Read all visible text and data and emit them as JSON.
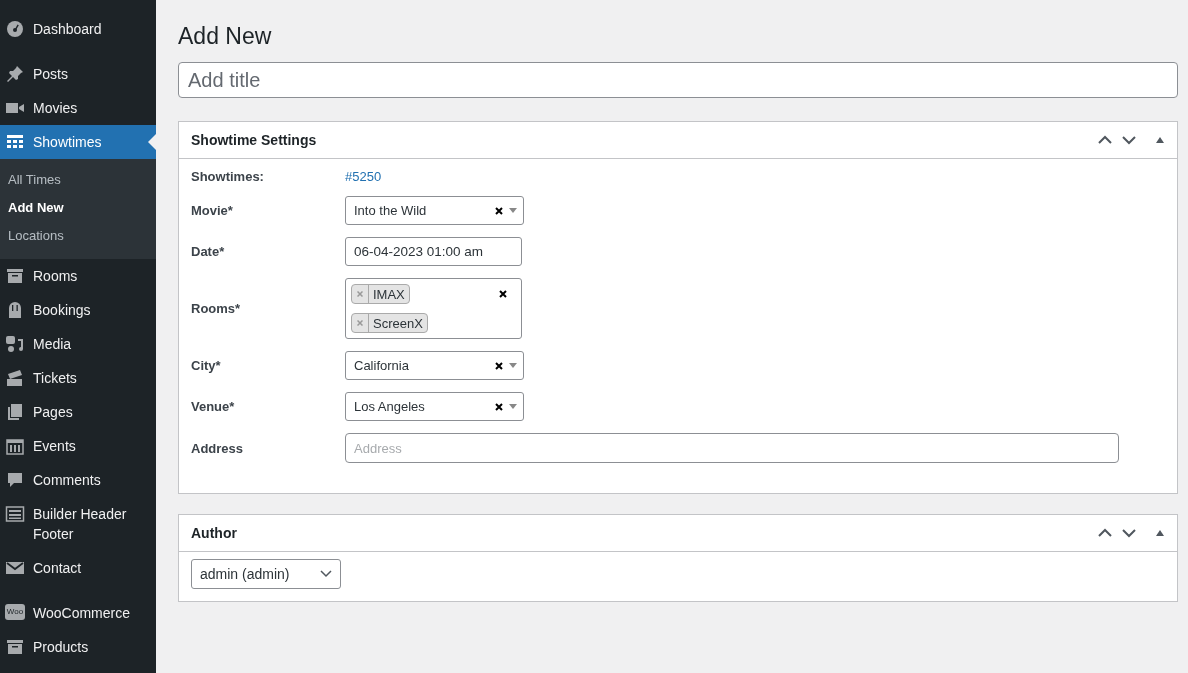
{
  "sidebar": {
    "groups": [
      [
        {
          "label": "Dashboard",
          "selected": false
        }
      ],
      [
        {
          "label": "Posts",
          "selected": false
        },
        {
          "label": "Movies",
          "selected": false
        },
        {
          "label": "Showtimes",
          "selected": true,
          "children": [
            {
              "label": "All Times",
              "selected": false
            },
            {
              "label": "Add New",
              "selected": true
            },
            {
              "label": "Locations",
              "selected": false
            }
          ]
        },
        {
          "label": "Rooms",
          "selected": false
        },
        {
          "label": "Bookings",
          "selected": false
        },
        {
          "label": "Media",
          "selected": false
        },
        {
          "label": "Tickets",
          "selected": false
        },
        {
          "label": "Pages",
          "selected": false
        },
        {
          "label": "Events",
          "selected": false
        },
        {
          "label": "Comments",
          "selected": false
        },
        {
          "label": "Builder Header Footer",
          "selected": false
        },
        {
          "label": "Contact",
          "selected": false
        }
      ],
      [
        {
          "label": "WooCommerce",
          "icon_text": "Woo",
          "selected": false
        },
        {
          "label": "Products",
          "selected": false
        }
      ]
    ]
  },
  "page": {
    "heading": "Add New",
    "title_field": {
      "placeholder": "Add title"
    }
  },
  "boxes": [
    {
      "title": "Showtime Settings",
      "fields": [
        {
          "label": "Showtimes:",
          "kind": "link",
          "value": "#5250"
        },
        {
          "label": "Movie*",
          "kind": "select",
          "value": "Into the Wild"
        },
        {
          "label": "Date*",
          "kind": "date",
          "value": "06-04-2023 01:00 am"
        },
        {
          "label": "Rooms*",
          "kind": "tags",
          "tags": [
            "IMAX",
            "ScreenX"
          ]
        },
        {
          "label": "City*",
          "kind": "select",
          "value": "California"
        },
        {
          "label": "Venue*",
          "kind": "select",
          "value": "Los Angeles"
        },
        {
          "label": "Address",
          "kind": "text",
          "placeholder": "Address"
        }
      ]
    },
    {
      "title": "Author",
      "fields": [
        {
          "kind": "dropdown",
          "value": "admin (admin)"
        }
      ]
    }
  ]
}
